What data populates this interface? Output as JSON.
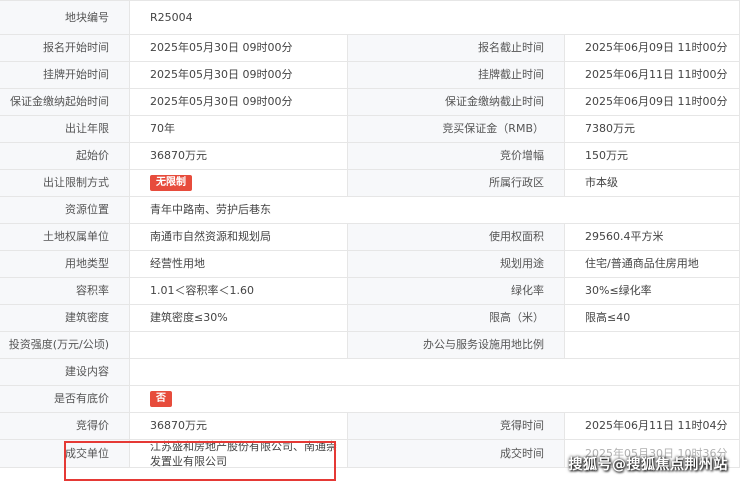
{
  "rows": {
    "r1": {
      "l1": "地块编号",
      "v1": "R25004"
    },
    "r2": {
      "l1": "报名开始时间",
      "v1": "2025年05月30日 09时00分",
      "l2": "报名截止时间",
      "v2": "2025年06月09日 11时00分"
    },
    "r3": {
      "l1": "挂牌开始时间",
      "v1": "2025年05月30日 09时00分",
      "l2": "挂牌截止时间",
      "v2": "2025年06月11日 11时00分"
    },
    "r4": {
      "l1": "保证金缴纳起始时间",
      "v1": "2025年05月30日 09时00分",
      "l2": "保证金缴纳截止时间",
      "v2": "2025年06月09日 11时00分"
    },
    "r5": {
      "l1": "出让年限",
      "v1": "70年",
      "l2": "竞买保证金（RMB）",
      "v2": "7380万元"
    },
    "r6": {
      "l1": "起始价",
      "v1": "36870万元",
      "l2": "竞价增幅",
      "v2": "150万元"
    },
    "r7": {
      "l1": "出让限制方式",
      "badge": "无限制",
      "l2": "所属行政区",
      "v2": "市本级"
    },
    "r8": {
      "l1": "资源位置",
      "v1": "青年中路南、劳护后巷东"
    },
    "r9": {
      "l1": "土地权属单位",
      "v1": "南通市自然资源和规划局",
      "l2": "使用权面积",
      "v2": "29560.4平方米"
    },
    "r10": {
      "l1": "用地类型",
      "v1": "经营性用地",
      "l2": "规划用途",
      "v2": "住宅/普通商品住房用地"
    },
    "r11": {
      "l1": "容积率",
      "v1": "1.01＜容积率＜1.60",
      "l2": "绿化率",
      "v2": "30%≤绿化率"
    },
    "r12": {
      "l1": "建筑密度",
      "v1": "建筑密度≤30%",
      "l2": "限高（米）",
      "v2": "限高≤40"
    },
    "r13": {
      "l1": "投资强度(万元/公顷)",
      "v1": "",
      "l2": "办公与服务设施用地比例",
      "v2": ""
    },
    "r14": {
      "l1": "建设内容",
      "v1": ""
    },
    "r15": {
      "l1": "是否有底价",
      "badge": "否"
    },
    "r16": {
      "l1": "竞得价",
      "v1": "36870万元",
      "l2": "竞得时间",
      "v2": "2025年06月11日 11时04分"
    },
    "r17": {
      "l1": "成交单位",
      "v1": "江苏盛和房地产股份有限公司、南通崇发置业有限公司",
      "l2": "成交时间",
      "v2": "2025年05月30日 10时36分"
    }
  },
  "watermark": "搜狐号@搜狐焦点荆州站",
  "colors": {
    "badge": "#e74c3c",
    "highlight_border": "#e53935",
    "label_bg": "#f7f8fa",
    "border": "#e6e6e6"
  }
}
